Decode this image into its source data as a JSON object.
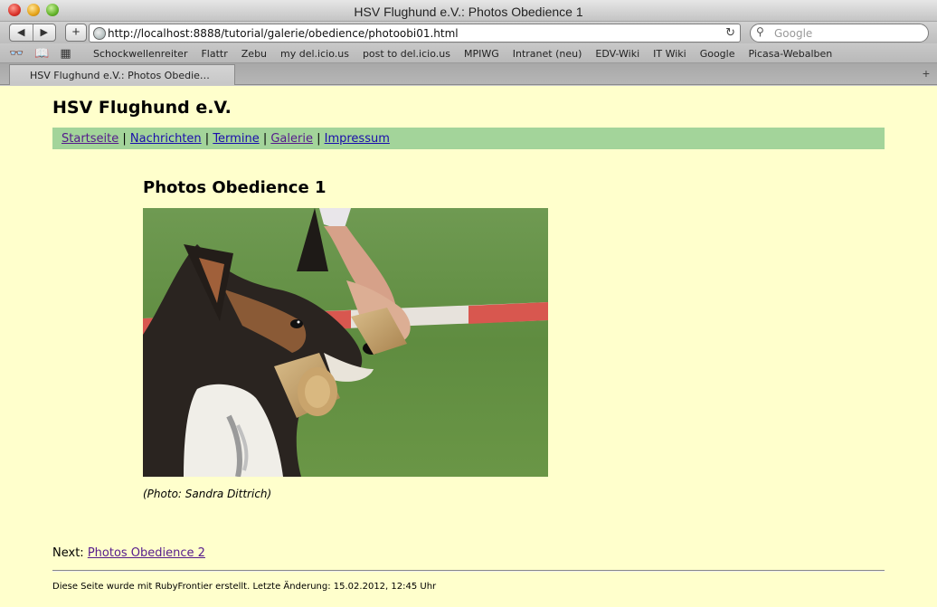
{
  "window": {
    "title": "HSV Flughund e.V.: Photos Obedience 1"
  },
  "toolbar": {
    "back_icon": "◀",
    "forward_icon": "▶",
    "add_icon": "+",
    "url": "http://localhost:8888/tutorial/galerie/obedience/photoobi01.html",
    "reload_icon": "↻",
    "search_placeholder": "Google"
  },
  "bookmarks": {
    "items": [
      "Schockwellenreiter",
      "Flattr",
      "Zebu",
      "my del.icio.us",
      "post to del.icio.us",
      "MPIWG",
      "Intranet (neu)",
      "EDV-Wiki",
      "IT Wiki",
      "Google",
      "Picasa-Webalben"
    ]
  },
  "tabs": {
    "active_label": "HSV Flughund e.V.: Photos Obedie…",
    "new_tab_icon": "+"
  },
  "page": {
    "site_title": "HSV Flughund e.V.",
    "nav": {
      "items": [
        "Startseite",
        "Nachrichten",
        "Termine",
        "Galerie",
        "Impressum"
      ],
      "separator": " | "
    },
    "heading": "Photos Obedience 1",
    "caption": "(Photo: Sandra Dittrich)",
    "next_label": "Next:",
    "next_link": "Photos Obedience 2",
    "footer": "Diese Seite wurde mit RubyFrontier erstellt. Letzte Änderung: 15.02.2012, 12:45 Uhr"
  }
}
